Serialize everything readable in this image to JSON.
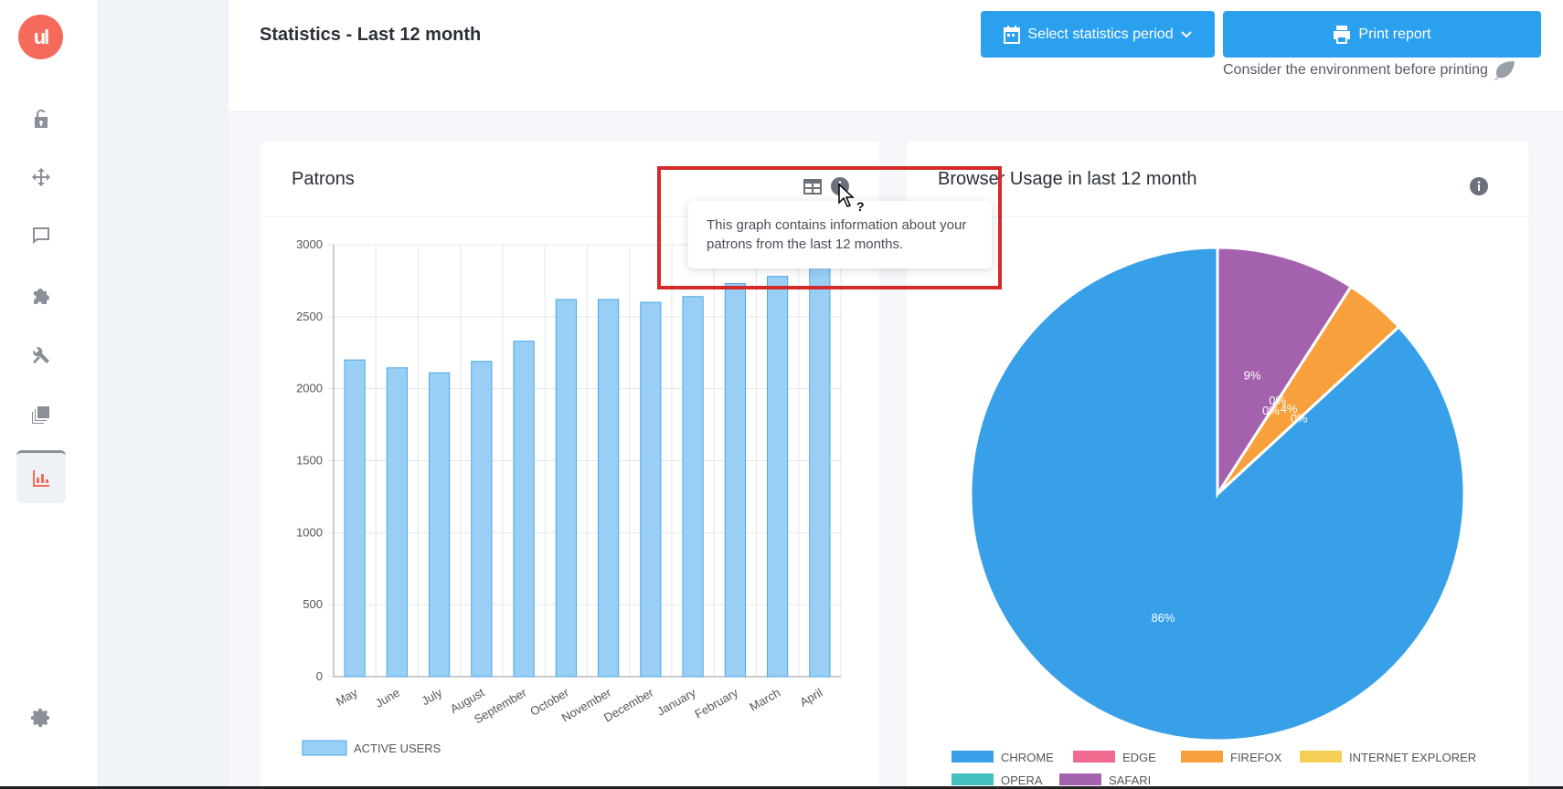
{
  "app": {
    "logo_text": "ul"
  },
  "sidebar": {
    "items": [
      {
        "name": "lock-open-icon"
      },
      {
        "name": "move-arrows-icon"
      },
      {
        "name": "chat-bubble-icon"
      },
      {
        "name": "puzzle-icon"
      },
      {
        "name": "tools-icon"
      },
      {
        "name": "layers-icon"
      },
      {
        "name": "bar-chart-icon",
        "active": true
      },
      {
        "name": "gear-icon"
      }
    ]
  },
  "header": {
    "title": "Statistics - Last 12 month",
    "period_button": "Select statistics period",
    "print_button": "Print report",
    "env_note": "Consider the environment before printing"
  },
  "patrons": {
    "title": "Patrons",
    "tooltip": "This graph contains information about your patrons from the last 12 months."
  },
  "browser": {
    "title": "Browser Usage in last 12 month"
  },
  "colors": {
    "accent": "#2aa0ee",
    "brand": "#f56a5a",
    "highlight": "#d42a2a"
  },
  "chart_data": [
    {
      "type": "bar",
      "categories": [
        "May",
        "June",
        "July",
        "August",
        "September",
        "October",
        "November",
        "December",
        "January",
        "February",
        "March",
        "April"
      ],
      "series": [
        {
          "name": "ACTIVE USERS",
          "values": [
            2200,
            2145,
            2110,
            2190,
            2330,
            2620,
            2620,
            2600,
            2640,
            2730,
            2780,
            2920
          ]
        }
      ],
      "ylim": [
        0,
        3000
      ],
      "yticks": [
        0,
        500,
        1000,
        1500,
        2000,
        2500,
        3000
      ],
      "grid": true,
      "legend": "bottom"
    },
    {
      "type": "pie",
      "labels": [
        "CHROME",
        "EDGE",
        "FIREFOX",
        "INTERNET EXPLORER",
        "OPERA",
        "SAFARI"
      ],
      "values": [
        86,
        0,
        4,
        0,
        0,
        9
      ],
      "label_texts": [
        "86%",
        "0%",
        "4%",
        "0%",
        "0%",
        "9%"
      ],
      "colors": [
        "#38a0e8",
        "#f06a90",
        "#f7a03c",
        "#f5cf55",
        "#44c0c0",
        "#a461ad"
      ],
      "legend": "bottom"
    }
  ]
}
